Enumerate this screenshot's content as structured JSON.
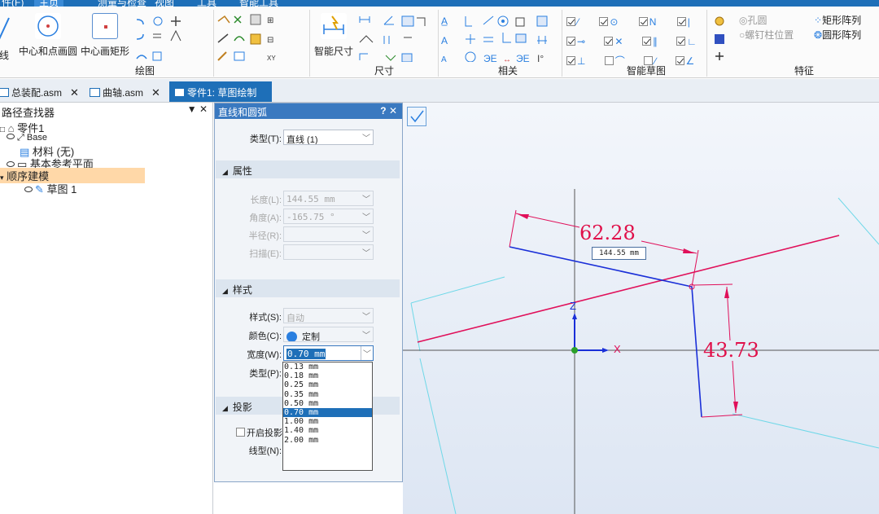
{
  "menu": {
    "items": [
      "件(F)",
      "主页",
      "测量与检查",
      "视图",
      "工具",
      "智能工具"
    ]
  },
  "ribbon": {
    "draw": {
      "line_label": "线",
      "circle_label": "中心和点画圆",
      "rect_label": "中心画矩形",
      "group_label": "绘图"
    },
    "dimension": {
      "smart_label": "智能尺寸",
      "group_label": "尺寸"
    },
    "relations": {
      "group_label": "相关"
    },
    "smart_sketch": {
      "group_label": "智能草图"
    },
    "features": {
      "hole": "孔圆",
      "rivet": "螺钉柱位置",
      "rect_pattern": "矩形阵列",
      "circ_pattern": "圆形阵列",
      "group_label": "特征"
    }
  },
  "tabs": [
    {
      "label": "总装配.asm",
      "close": "✕"
    },
    {
      "label": "曲轴.asm",
      "close": "✕"
    },
    {
      "label": "零件1: 草图绘制",
      "close": ""
    }
  ],
  "left_panel": {
    "title": "路径查找器",
    "tools": "▼ ✕",
    "tree": {
      "part": "零件1",
      "base": "Base",
      "material": "材料 (无)",
      "ref_planes": "基本参考平面",
      "ordered": "顺序建模",
      "sketch": "草图 1"
    }
  },
  "dialog": {
    "title": "直线和圆弧",
    "title_btns": "? ✕",
    "type_label": "类型(T):",
    "type_value": "直线 (1)",
    "props_section": "属性",
    "length_label": "长度(L):",
    "length_value": "144.55 mm",
    "angle_label": "角度(A):",
    "angle_value": "-165.75 °",
    "radius_label": "半径(R):",
    "sweep_label": "扫描(E):",
    "style_section": "样式",
    "style_label": "样式(S):",
    "style_value": "自动",
    "color_label": "颜色(C):",
    "color_value": "定制",
    "width_label": "宽度(W):",
    "width_value": "0.70 mm",
    "linetype_label": "类型(P):",
    "projection_section": "投影",
    "enable_projection": "开启投影",
    "line_type_label": "线型(N):",
    "width_options": [
      "0.13 mm",
      "0.18 mm",
      "0.25 mm",
      "0.35 mm",
      "0.50 mm",
      "0.70 mm",
      "1.00 mm",
      "1.40 mm",
      "2.00 mm"
    ],
    "selected_width_index": 5
  },
  "canvas": {
    "dim_top": "62.28",
    "dim_right": "43.73",
    "len_box": "144.55 mm",
    "axis_z": "Z",
    "axis_x": "X"
  },
  "colors": {
    "accent": "#1e6fb8",
    "dim_red": "#e0104a",
    "sketch_blue": "#1a2fd8"
  }
}
